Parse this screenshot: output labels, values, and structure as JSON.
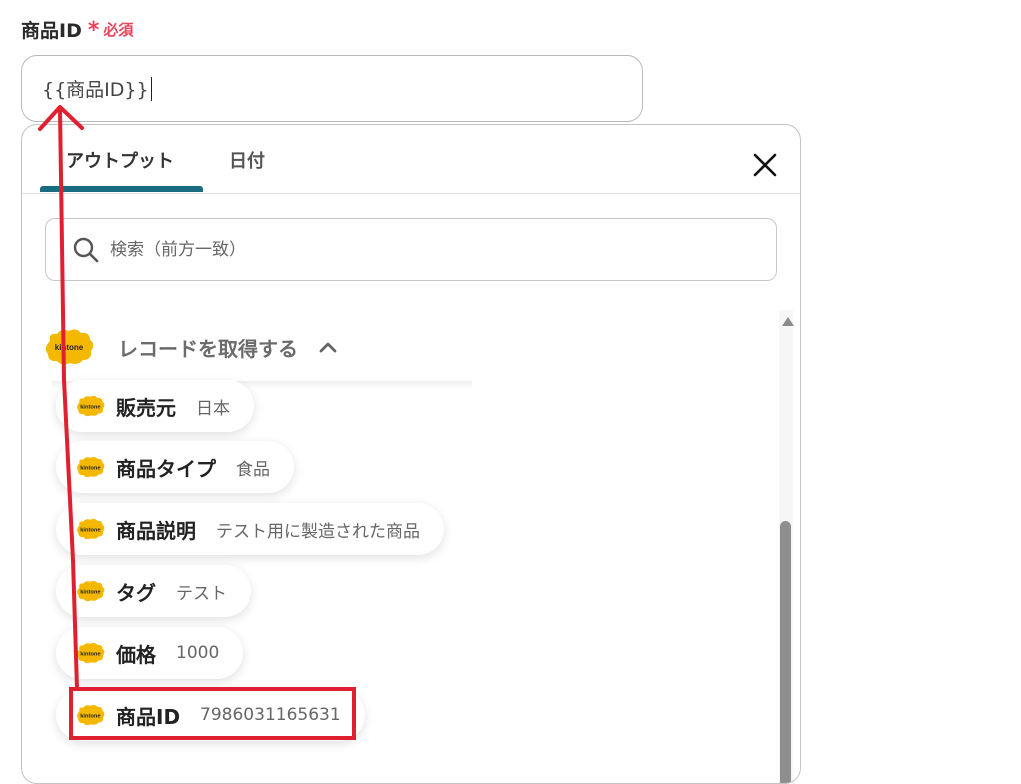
{
  "field": {
    "label": "商品ID",
    "required_mark": "*",
    "required_text": "必須",
    "value": "{{商品ID}}"
  },
  "panel": {
    "tabs": [
      {
        "label": "アウトプット"
      },
      {
        "label": "日付"
      }
    ],
    "search_placeholder": "検索（前方一致）",
    "group_title": "レコードを取得する",
    "group_logo": "kintone",
    "items": [
      {
        "key": "販売元",
        "value": "日本",
        "logo": "kintone"
      },
      {
        "key": "商品タイプ",
        "value": "食品",
        "logo": "kintone"
      },
      {
        "key": "商品説明",
        "value": "テスト用に製造された商品",
        "logo": "kintone"
      },
      {
        "key": "タグ",
        "value": "テスト",
        "logo": "kintone"
      },
      {
        "key": "価格",
        "value": "1000",
        "logo": "kintone"
      },
      {
        "key": "商品ID",
        "value": "7986031165631",
        "logo": "kintone"
      }
    ]
  },
  "colors": {
    "accent": "#1a6c82",
    "required": "#e8445a",
    "annotation": "#e02030",
    "logo": "#f5b800"
  }
}
